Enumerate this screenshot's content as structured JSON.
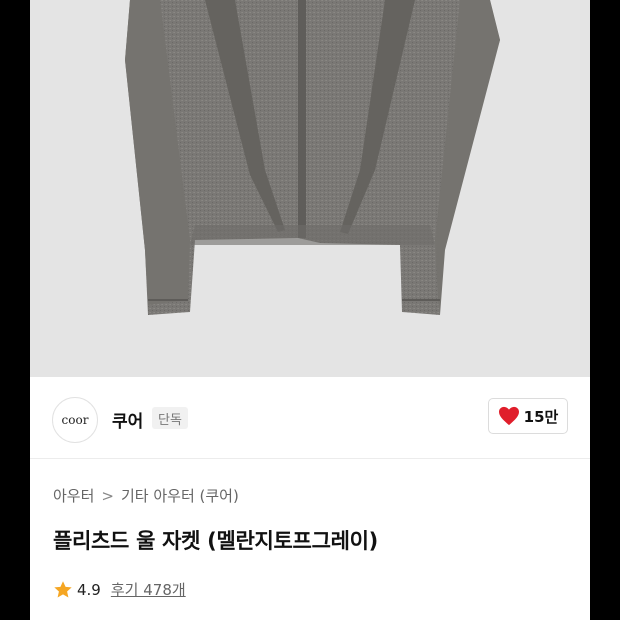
{
  "product_image": {
    "alt": "product-photo"
  },
  "brand": {
    "logo_text": "coor",
    "name": "쿠어",
    "badge": "단독"
  },
  "like": {
    "count": "15만",
    "color": "#e01e2b"
  },
  "breadcrumb": {
    "level1": "아우터",
    "separator": ">",
    "level2": "기타 아우터 (쿠어)"
  },
  "product": {
    "title": "플리츠드 울 자켓 (멜란지토프그레이)"
  },
  "rating": {
    "score": "4.9",
    "reviews_label": "후기 478개",
    "star_color": "#f5a623"
  }
}
